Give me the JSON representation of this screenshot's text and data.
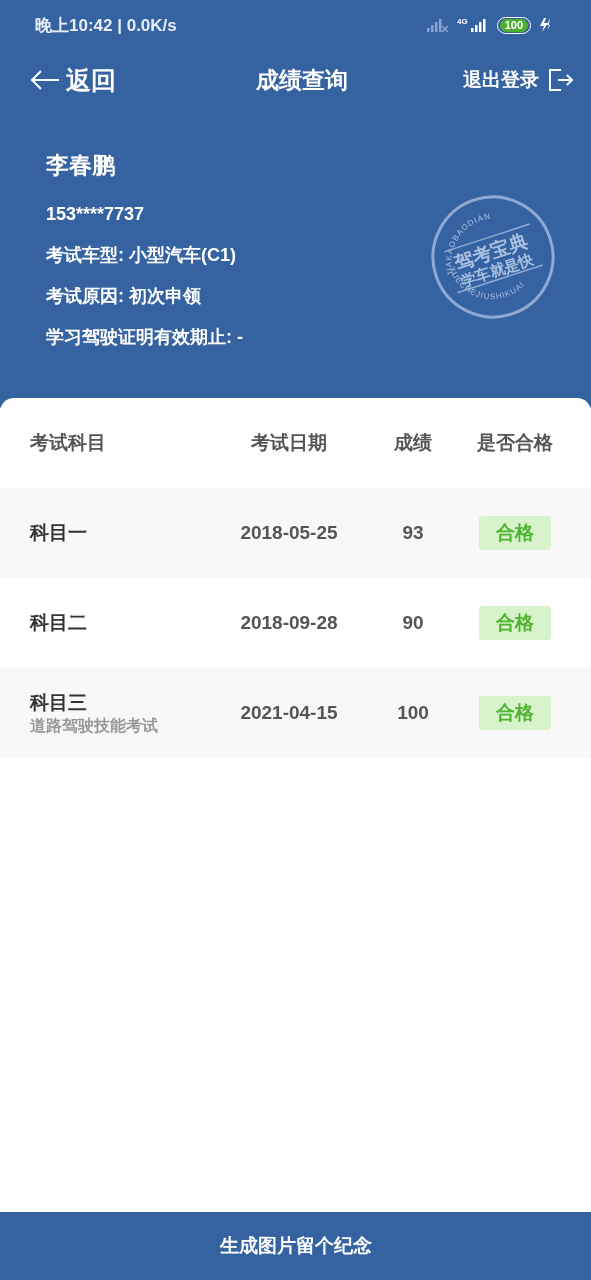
{
  "status_bar": {
    "time_speed": "晚上10:42 | 0.0K/s",
    "network": "4G",
    "battery": "100"
  },
  "nav": {
    "back": "返回",
    "title": "成绩查询",
    "logout": "退出登录"
  },
  "profile": {
    "name": "李春鹏",
    "phone": "153****7737",
    "lines": [
      "考试车型: 小型汽车(C1)",
      "考试原因: 初次申领",
      "学习驾驶证明有效期止: -"
    ],
    "seal": {
      "title": "驾考宝典",
      "slogan": "学车就是快",
      "top_arc": "JIAKAOBAODIAN",
      "bottom_arc": "XUECHEJIUSHIKUAI"
    }
  },
  "table": {
    "columns": [
      "考试科目",
      "考试日期",
      "成绩",
      "是否合格"
    ],
    "rows": [
      {
        "subject": "科目一",
        "date": "2018-05-25",
        "score": "93",
        "result": "合格",
        "passed": true
      },
      {
        "subject": "科目二",
        "date": "2018-09-28",
        "score": "90",
        "result": "合格",
        "passed": true
      },
      {
        "subject": "科目三",
        "note": "道路驾驶技能考试",
        "date": "2021-04-15",
        "score": "100",
        "result": "合格",
        "passed": true
      }
    ]
  },
  "footer_button": "生成图片留个纪念"
}
